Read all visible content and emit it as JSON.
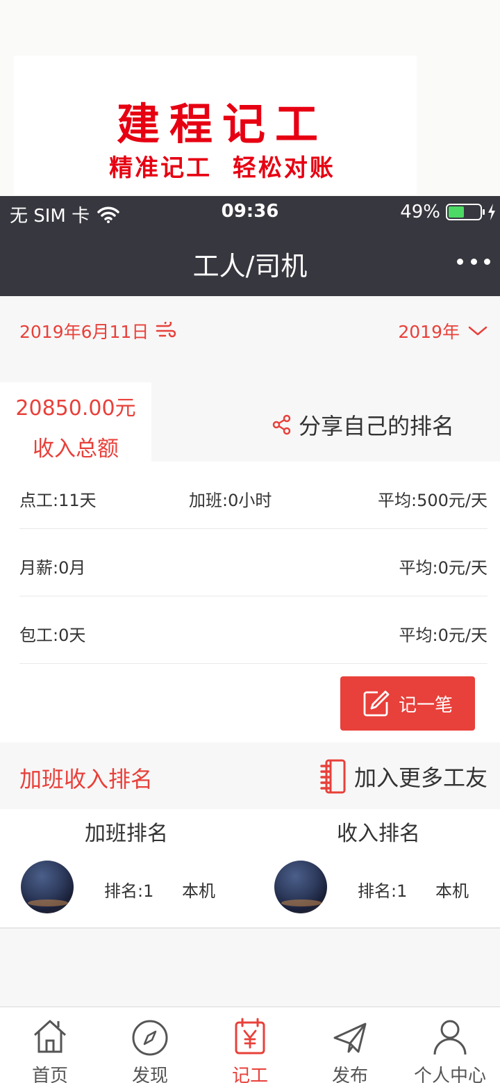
{
  "promo": {
    "title": "建程记工",
    "subtitle": "精准记工  轻松对账"
  },
  "status_bar": {
    "carrier": "无 SIM 卡",
    "time": "09:36",
    "battery_text": "49%",
    "battery_level": 0.49
  },
  "header": {
    "title": "工人/司机"
  },
  "date_bar": {
    "date": "2019年6月11日",
    "year_select": "2019年"
  },
  "summary": {
    "amount": "20850.00元",
    "amount_label": "收入总额",
    "share_label": "分享自己的排名"
  },
  "stats": {
    "rows": [
      {
        "left": "点工:11天",
        "middle": "加班:0小时",
        "right": "平均:500元/天"
      },
      {
        "left": "月薪:0月",
        "middle": "",
        "right": "平均:0元/天"
      },
      {
        "left": "包工:0天",
        "middle": "",
        "right": "平均:0元/天"
      }
    ],
    "record_button": "记一笔"
  },
  "ranking": {
    "title": "加班收入排名",
    "join_label": "加入更多工友",
    "columns": [
      {
        "title": "加班排名",
        "rank": "排名:1",
        "name": "本机"
      },
      {
        "title": "收入排名",
        "rank": "排名:1",
        "name": "本机"
      }
    ]
  },
  "tabbar": {
    "items": [
      {
        "label": "首页",
        "icon": "home-icon"
      },
      {
        "label": "发现",
        "icon": "compass-icon"
      },
      {
        "label": "记工",
        "icon": "calendar-yen-icon",
        "active": true
      },
      {
        "label": "发布",
        "icon": "paper-plane-icon"
      },
      {
        "label": "个人中心",
        "icon": "user-icon"
      }
    ]
  },
  "colors": {
    "accent": "#e8403a",
    "header_bg": "#37373f",
    "promo_red": "#e60012",
    "battery_green": "#4cd964"
  }
}
